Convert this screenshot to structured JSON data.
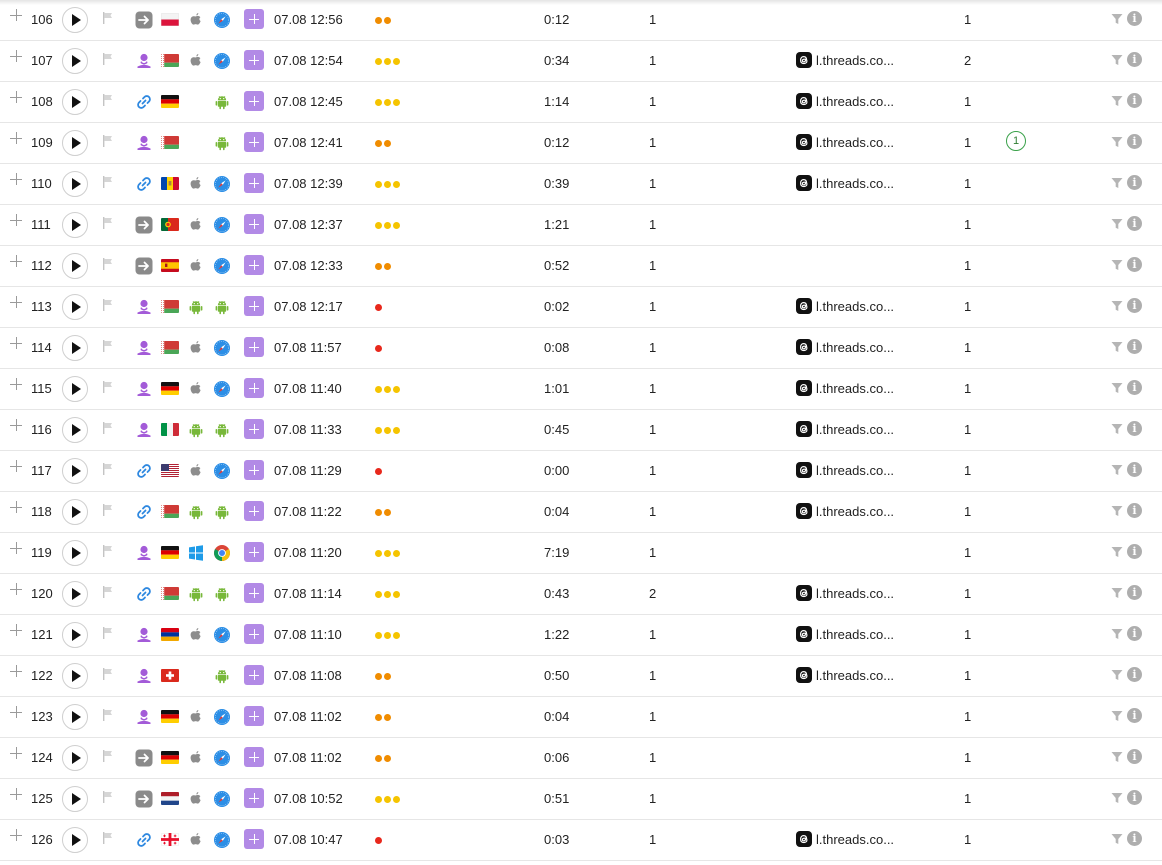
{
  "colors": {
    "dot_orange": "#f08c00",
    "dot_yellow": "#f5c400",
    "dot_red": "#e8281c",
    "accent_purple": "#b28ae6"
  },
  "rows": [
    {
      "num": "106",
      "source": "direct",
      "country": "pl",
      "os": "apple",
      "browser": "safari",
      "datetime": "07.08 12:56",
      "dots": 2,
      "dot_color": "orange",
      "duration": "0:12",
      "views": "1",
      "referrer": "",
      "count": "1",
      "badge": ""
    },
    {
      "num": "107",
      "source": "social",
      "country": "by",
      "os": "apple",
      "browser": "safari",
      "datetime": "07.08 12:54",
      "dots": 3,
      "dot_color": "yellow",
      "duration": "0:34",
      "views": "1",
      "referrer": "l.threads.co...",
      "count": "2",
      "badge": ""
    },
    {
      "num": "108",
      "source": "link",
      "country": "de",
      "os": "",
      "browser": "android",
      "datetime": "07.08 12:45",
      "dots": 3,
      "dot_color": "yellow",
      "duration": "1:14",
      "views": "1",
      "referrer": "l.threads.co...",
      "count": "1",
      "badge": ""
    },
    {
      "num": "109",
      "source": "social",
      "country": "by",
      "os": "",
      "browser": "android",
      "datetime": "07.08 12:41",
      "dots": 2,
      "dot_color": "orange",
      "duration": "0:12",
      "views": "1",
      "referrer": "l.threads.co...",
      "count": "1",
      "badge": "1"
    },
    {
      "num": "110",
      "source": "link",
      "country": "md",
      "os": "apple",
      "browser": "safari",
      "datetime": "07.08 12:39",
      "dots": 3,
      "dot_color": "yellow",
      "duration": "0:39",
      "views": "1",
      "referrer": "l.threads.co...",
      "count": "1",
      "badge": ""
    },
    {
      "num": "111",
      "source": "direct",
      "country": "pt",
      "os": "apple",
      "browser": "safari",
      "datetime": "07.08 12:37",
      "dots": 3,
      "dot_color": "yellow",
      "duration": "1:21",
      "views": "1",
      "referrer": "",
      "count": "1",
      "badge": ""
    },
    {
      "num": "112",
      "source": "direct",
      "country": "es",
      "os": "apple",
      "browser": "safari",
      "datetime": "07.08 12:33",
      "dots": 2,
      "dot_color": "orange",
      "duration": "0:52",
      "views": "1",
      "referrer": "",
      "count": "1",
      "badge": ""
    },
    {
      "num": "113",
      "source": "social",
      "country": "by",
      "os": "android",
      "browser": "android",
      "datetime": "07.08 12:17",
      "dots": 1,
      "dot_color": "red",
      "duration": "0:02",
      "views": "1",
      "referrer": "l.threads.co...",
      "count": "1",
      "badge": ""
    },
    {
      "num": "114",
      "source": "social",
      "country": "by",
      "os": "apple",
      "browser": "safari",
      "datetime": "07.08 11:57",
      "dots": 1,
      "dot_color": "red",
      "duration": "0:08",
      "views": "1",
      "referrer": "l.threads.co...",
      "count": "1",
      "badge": ""
    },
    {
      "num": "115",
      "source": "social",
      "country": "de",
      "os": "apple",
      "browser": "safari",
      "datetime": "07.08 11:40",
      "dots": 3,
      "dot_color": "yellow",
      "duration": "1:01",
      "views": "1",
      "referrer": "l.threads.co...",
      "count": "1",
      "badge": ""
    },
    {
      "num": "116",
      "source": "social",
      "country": "it",
      "os": "android",
      "browser": "android",
      "datetime": "07.08 11:33",
      "dots": 3,
      "dot_color": "yellow",
      "duration": "0:45",
      "views": "1",
      "referrer": "l.threads.co...",
      "count": "1",
      "badge": ""
    },
    {
      "num": "117",
      "source": "link",
      "country": "us",
      "os": "apple",
      "browser": "safari",
      "datetime": "07.08 11:29",
      "dots": 1,
      "dot_color": "red",
      "duration": "0:00",
      "views": "1",
      "referrer": "l.threads.co...",
      "count": "1",
      "badge": ""
    },
    {
      "num": "118",
      "source": "link",
      "country": "by",
      "os": "android",
      "browser": "android",
      "datetime": "07.08 11:22",
      "dots": 2,
      "dot_color": "orange",
      "duration": "0:04",
      "views": "1",
      "referrer": "l.threads.co...",
      "count": "1",
      "badge": ""
    },
    {
      "num": "119",
      "source": "social",
      "country": "de",
      "os": "windows",
      "browser": "chrome",
      "datetime": "07.08 11:20",
      "dots": 3,
      "dot_color": "yellow",
      "duration": "7:19",
      "views": "1",
      "referrer": "",
      "count": "1",
      "badge": ""
    },
    {
      "num": "120",
      "source": "link",
      "country": "by",
      "os": "android",
      "browser": "android",
      "datetime": "07.08 11:14",
      "dots": 3,
      "dot_color": "yellow",
      "duration": "0:43",
      "views": "2",
      "referrer": "l.threads.co...",
      "count": "1",
      "badge": ""
    },
    {
      "num": "121",
      "source": "social",
      "country": "am",
      "os": "apple",
      "browser": "safari",
      "datetime": "07.08 11:10",
      "dots": 3,
      "dot_color": "yellow",
      "duration": "1:22",
      "views": "1",
      "referrer": "l.threads.co...",
      "count": "1",
      "badge": ""
    },
    {
      "num": "122",
      "source": "social",
      "country": "ch",
      "os": "",
      "browser": "android",
      "datetime": "07.08 11:08",
      "dots": 2,
      "dot_color": "orange",
      "duration": "0:50",
      "views": "1",
      "referrer": "l.threads.co...",
      "count": "1",
      "badge": ""
    },
    {
      "num": "123",
      "source": "social",
      "country": "de",
      "os": "apple",
      "browser": "safari",
      "datetime": "07.08 11:02",
      "dots": 2,
      "dot_color": "orange",
      "duration": "0:04",
      "views": "1",
      "referrer": "",
      "count": "1",
      "badge": ""
    },
    {
      "num": "124",
      "source": "direct",
      "country": "de",
      "os": "apple",
      "browser": "safari",
      "datetime": "07.08 11:02",
      "dots": 2,
      "dot_color": "orange",
      "duration": "0:06",
      "views": "1",
      "referrer": "",
      "count": "1",
      "badge": ""
    },
    {
      "num": "125",
      "source": "direct",
      "country": "nl",
      "os": "apple",
      "browser": "safari",
      "datetime": "07.08 10:52",
      "dots": 3,
      "dot_color": "yellow",
      "duration": "0:51",
      "views": "1",
      "referrer": "",
      "count": "1",
      "badge": ""
    },
    {
      "num": "126",
      "source": "link",
      "country": "ge",
      "os": "apple",
      "browser": "safari",
      "datetime": "07.08 10:47",
      "dots": 1,
      "dot_color": "red",
      "duration": "0:03",
      "views": "1",
      "referrer": "l.threads.co...",
      "count": "1",
      "badge": ""
    }
  ]
}
